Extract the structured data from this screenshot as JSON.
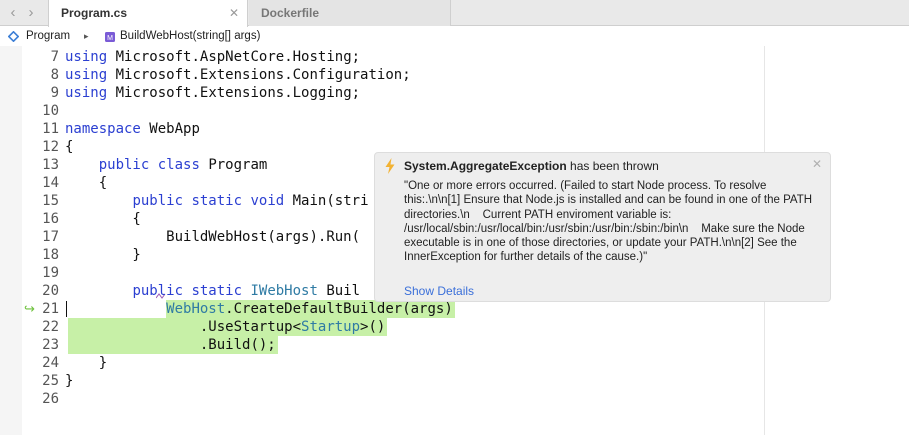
{
  "tabs": [
    {
      "label": "Program.cs",
      "close": "✕"
    },
    {
      "label": "Dockerfile"
    }
  ],
  "nav": {
    "back": "‹",
    "forward": "›"
  },
  "breadcrumb": {
    "namespace": "Program",
    "separator": "▸",
    "method": "BuildWebHost(string[] args)",
    "namespace_icon": "namespace-diamond-icon",
    "method_icon": "method-cube-icon"
  },
  "editor": {
    "lines": [
      {
        "n": "7",
        "text": "using Microsoft.AspNetCore.Hosting;"
      },
      {
        "n": "8",
        "text": "using Microsoft.Extensions.Configuration;"
      },
      {
        "n": "9",
        "text": "using Microsoft.Extensions.Logging;"
      },
      {
        "n": "10",
        "text": ""
      },
      {
        "n": "11",
        "text": "namespace WebApp"
      },
      {
        "n": "12",
        "text": "{"
      },
      {
        "n": "13",
        "text": "    public class Program"
      },
      {
        "n": "14",
        "text": "    {"
      },
      {
        "n": "15",
        "text": "        public static void Main(stri"
      },
      {
        "n": "16",
        "text": "        {"
      },
      {
        "n": "17",
        "text": "            BuildWebHost(args).Run("
      },
      {
        "n": "18",
        "text": "        }"
      },
      {
        "n": "19",
        "text": ""
      },
      {
        "n": "20",
        "text": "        public static IWebHost Buil"
      },
      {
        "n": "21",
        "text": "            WebHost.CreateDefaultBuilder(args)"
      },
      {
        "n": "22",
        "text": "                .UseStartup<Startup>()"
      },
      {
        "n": "23",
        "text": "                .Build();"
      },
      {
        "n": "24",
        "text": "    }"
      },
      {
        "n": "25",
        "text": "}"
      },
      {
        "n": "26",
        "text": ""
      }
    ],
    "current_line": "21",
    "exec_arrow": "↪",
    "colors": {
      "keyword": "#2b3fd1",
      "type": "#2f7ba4",
      "highlight": "#c7f0a7"
    }
  },
  "exception": {
    "icon": "lightning-bolt-icon",
    "type": "System.AggregateException",
    "suffix": " has been thrown",
    "message": "\"One or more errors occurred. (Failed to start Node process. To resolve this:.\\n\\n[1] Ensure that Node.js is installed and can be found in one of the PATH directories.\\n    Current PATH enviroment variable is: /usr/local/sbin:/usr/local/bin:/usr/sbin:/usr/bin:/sbin:/bin\\n    Make sure the Node executable is in one of those directories, or update your PATH.\\n\\n[2] See the InnerException for further details of the cause.)\"",
    "link": "Show Details",
    "close": "✕"
  }
}
